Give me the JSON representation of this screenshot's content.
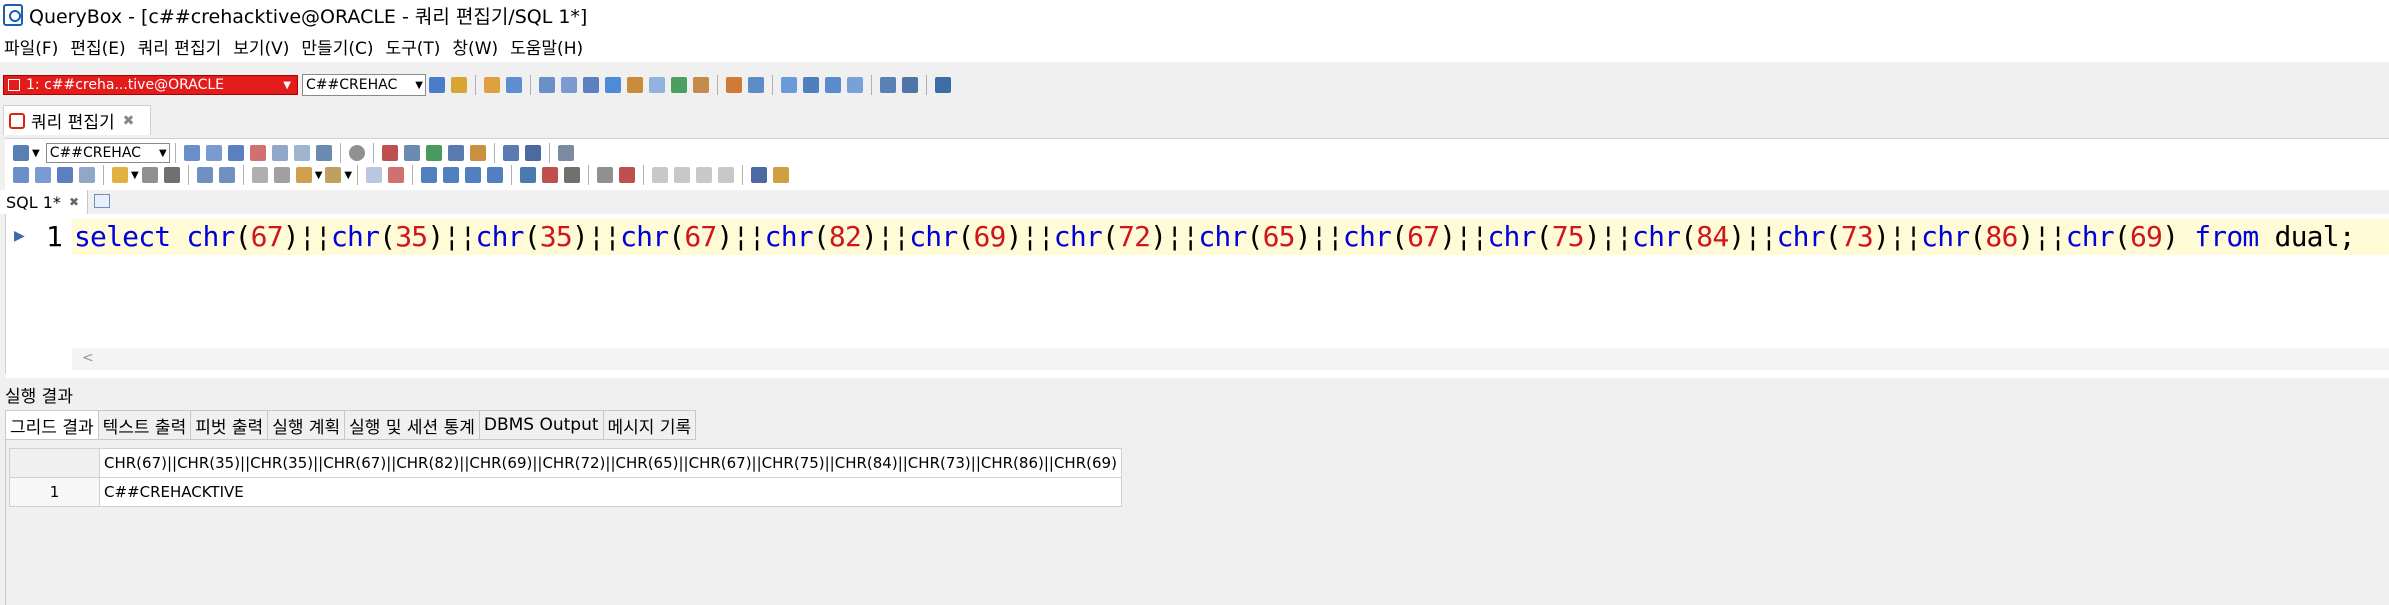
{
  "window": {
    "title": "QueryBox - [c##crehacktive@ORACLE - 쿼리 편집기/SQL 1*]"
  },
  "menu": [
    "파일(F)",
    "편집(E)",
    "쿼리 편집기",
    "보기(V)",
    "만들기(C)",
    "도구(T)",
    "창(W)",
    "도움말(H)"
  ],
  "toolbar": {
    "connection": "1: c##creha...tive@ORACLE",
    "schema": "C##CREHAC"
  },
  "doc_tab": {
    "label": "쿼리 편집기"
  },
  "editor_toolbar": {
    "schema": "C##CREHAC"
  },
  "sql_tab": {
    "label": "SQL 1*"
  },
  "editor": {
    "line_number": "1",
    "code": "select chr(67)||chr(35)||chr(35)||chr(67)||chr(82)||chr(69)||chr(72)||chr(65)||chr(67)||chr(75)||chr(84)||chr(73)||chr(86)||chr(69) from dual;"
  },
  "results": {
    "label": "실행 결과",
    "tabs": [
      "그리드 결과",
      "텍스트 출력",
      "피벗 출력",
      "실행 계획",
      "실행 및 세션 통계",
      "DBMS Output",
      "메시지 기록"
    ],
    "columns": [
      "CHR(67)||CHR(35)||CHR(35)||CHR(67)||CHR(82)||CHR(69)||CHR(72)||CHR(65)||CHR(67)||CHR(75)||CHR(84)||CHR(73)||CHR(86)||CHR(69)"
    ],
    "rows": [
      {
        "num": "1",
        "value": "C##CREHACKTIVE"
      }
    ]
  }
}
